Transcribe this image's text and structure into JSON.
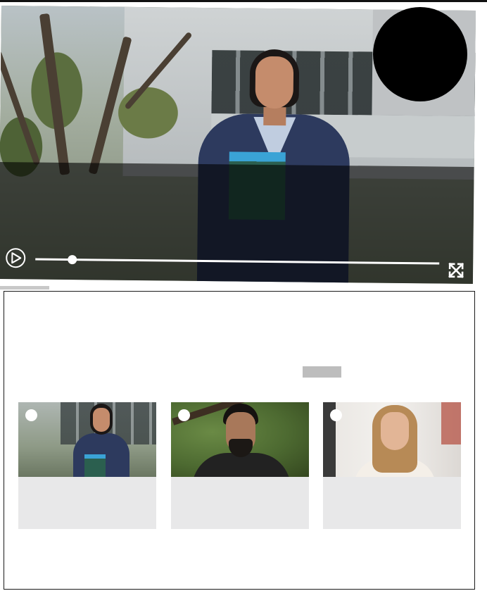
{
  "player": {
    "progress_fraction": 0.09,
    "colors": {
      "overlay": "#000000",
      "controls": "#ffffff"
    },
    "icons": [
      "play-icon",
      "fullscreen-icon"
    ]
  },
  "video_list": {
    "items": [
      {
        "icon": "video-thumbnail-woman-blazer"
      },
      {
        "icon": "video-thumbnail-man-beard"
      },
      {
        "icon": "video-thumbnail-woman-blonde"
      }
    ]
  }
}
